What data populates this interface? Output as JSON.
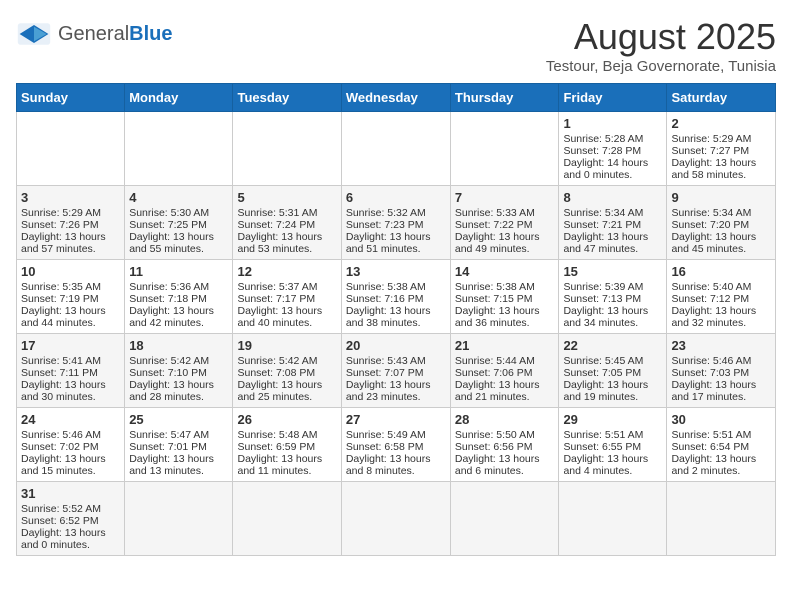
{
  "header": {
    "logo_general": "General",
    "logo_blue": "Blue",
    "month_title": "August 2025",
    "location": "Testour, Beja Governorate, Tunisia"
  },
  "weekdays": [
    "Sunday",
    "Monday",
    "Tuesday",
    "Wednesday",
    "Thursday",
    "Friday",
    "Saturday"
  ],
  "weeks": [
    [
      {
        "day": "",
        "info": ""
      },
      {
        "day": "",
        "info": ""
      },
      {
        "day": "",
        "info": ""
      },
      {
        "day": "",
        "info": ""
      },
      {
        "day": "",
        "info": ""
      },
      {
        "day": "1",
        "info": "Sunrise: 5:28 AM\nSunset: 7:28 PM\nDaylight: 14 hours and 0 minutes."
      },
      {
        "day": "2",
        "info": "Sunrise: 5:29 AM\nSunset: 7:27 PM\nDaylight: 13 hours and 58 minutes."
      }
    ],
    [
      {
        "day": "3",
        "info": "Sunrise: 5:29 AM\nSunset: 7:26 PM\nDaylight: 13 hours and 57 minutes."
      },
      {
        "day": "4",
        "info": "Sunrise: 5:30 AM\nSunset: 7:25 PM\nDaylight: 13 hours and 55 minutes."
      },
      {
        "day": "5",
        "info": "Sunrise: 5:31 AM\nSunset: 7:24 PM\nDaylight: 13 hours and 53 minutes."
      },
      {
        "day": "6",
        "info": "Sunrise: 5:32 AM\nSunset: 7:23 PM\nDaylight: 13 hours and 51 minutes."
      },
      {
        "day": "7",
        "info": "Sunrise: 5:33 AM\nSunset: 7:22 PM\nDaylight: 13 hours and 49 minutes."
      },
      {
        "day": "8",
        "info": "Sunrise: 5:34 AM\nSunset: 7:21 PM\nDaylight: 13 hours and 47 minutes."
      },
      {
        "day": "9",
        "info": "Sunrise: 5:34 AM\nSunset: 7:20 PM\nDaylight: 13 hours and 45 minutes."
      }
    ],
    [
      {
        "day": "10",
        "info": "Sunrise: 5:35 AM\nSunset: 7:19 PM\nDaylight: 13 hours and 44 minutes."
      },
      {
        "day": "11",
        "info": "Sunrise: 5:36 AM\nSunset: 7:18 PM\nDaylight: 13 hours and 42 minutes."
      },
      {
        "day": "12",
        "info": "Sunrise: 5:37 AM\nSunset: 7:17 PM\nDaylight: 13 hours and 40 minutes."
      },
      {
        "day": "13",
        "info": "Sunrise: 5:38 AM\nSunset: 7:16 PM\nDaylight: 13 hours and 38 minutes."
      },
      {
        "day": "14",
        "info": "Sunrise: 5:38 AM\nSunset: 7:15 PM\nDaylight: 13 hours and 36 minutes."
      },
      {
        "day": "15",
        "info": "Sunrise: 5:39 AM\nSunset: 7:13 PM\nDaylight: 13 hours and 34 minutes."
      },
      {
        "day": "16",
        "info": "Sunrise: 5:40 AM\nSunset: 7:12 PM\nDaylight: 13 hours and 32 minutes."
      }
    ],
    [
      {
        "day": "17",
        "info": "Sunrise: 5:41 AM\nSunset: 7:11 PM\nDaylight: 13 hours and 30 minutes."
      },
      {
        "day": "18",
        "info": "Sunrise: 5:42 AM\nSunset: 7:10 PM\nDaylight: 13 hours and 28 minutes."
      },
      {
        "day": "19",
        "info": "Sunrise: 5:42 AM\nSunset: 7:08 PM\nDaylight: 13 hours and 25 minutes."
      },
      {
        "day": "20",
        "info": "Sunrise: 5:43 AM\nSunset: 7:07 PM\nDaylight: 13 hours and 23 minutes."
      },
      {
        "day": "21",
        "info": "Sunrise: 5:44 AM\nSunset: 7:06 PM\nDaylight: 13 hours and 21 minutes."
      },
      {
        "day": "22",
        "info": "Sunrise: 5:45 AM\nSunset: 7:05 PM\nDaylight: 13 hours and 19 minutes."
      },
      {
        "day": "23",
        "info": "Sunrise: 5:46 AM\nSunset: 7:03 PM\nDaylight: 13 hours and 17 minutes."
      }
    ],
    [
      {
        "day": "24",
        "info": "Sunrise: 5:46 AM\nSunset: 7:02 PM\nDaylight: 13 hours and 15 minutes."
      },
      {
        "day": "25",
        "info": "Sunrise: 5:47 AM\nSunset: 7:01 PM\nDaylight: 13 hours and 13 minutes."
      },
      {
        "day": "26",
        "info": "Sunrise: 5:48 AM\nSunset: 6:59 PM\nDaylight: 13 hours and 11 minutes."
      },
      {
        "day": "27",
        "info": "Sunrise: 5:49 AM\nSunset: 6:58 PM\nDaylight: 13 hours and 8 minutes."
      },
      {
        "day": "28",
        "info": "Sunrise: 5:50 AM\nSunset: 6:56 PM\nDaylight: 13 hours and 6 minutes."
      },
      {
        "day": "29",
        "info": "Sunrise: 5:51 AM\nSunset: 6:55 PM\nDaylight: 13 hours and 4 minutes."
      },
      {
        "day": "30",
        "info": "Sunrise: 5:51 AM\nSunset: 6:54 PM\nDaylight: 13 hours and 2 minutes."
      }
    ],
    [
      {
        "day": "31",
        "info": "Sunrise: 5:52 AM\nSunset: 6:52 PM\nDaylight: 13 hours and 0 minutes."
      },
      {
        "day": "",
        "info": ""
      },
      {
        "day": "",
        "info": ""
      },
      {
        "day": "",
        "info": ""
      },
      {
        "day": "",
        "info": ""
      },
      {
        "day": "",
        "info": ""
      },
      {
        "day": "",
        "info": ""
      }
    ]
  ]
}
